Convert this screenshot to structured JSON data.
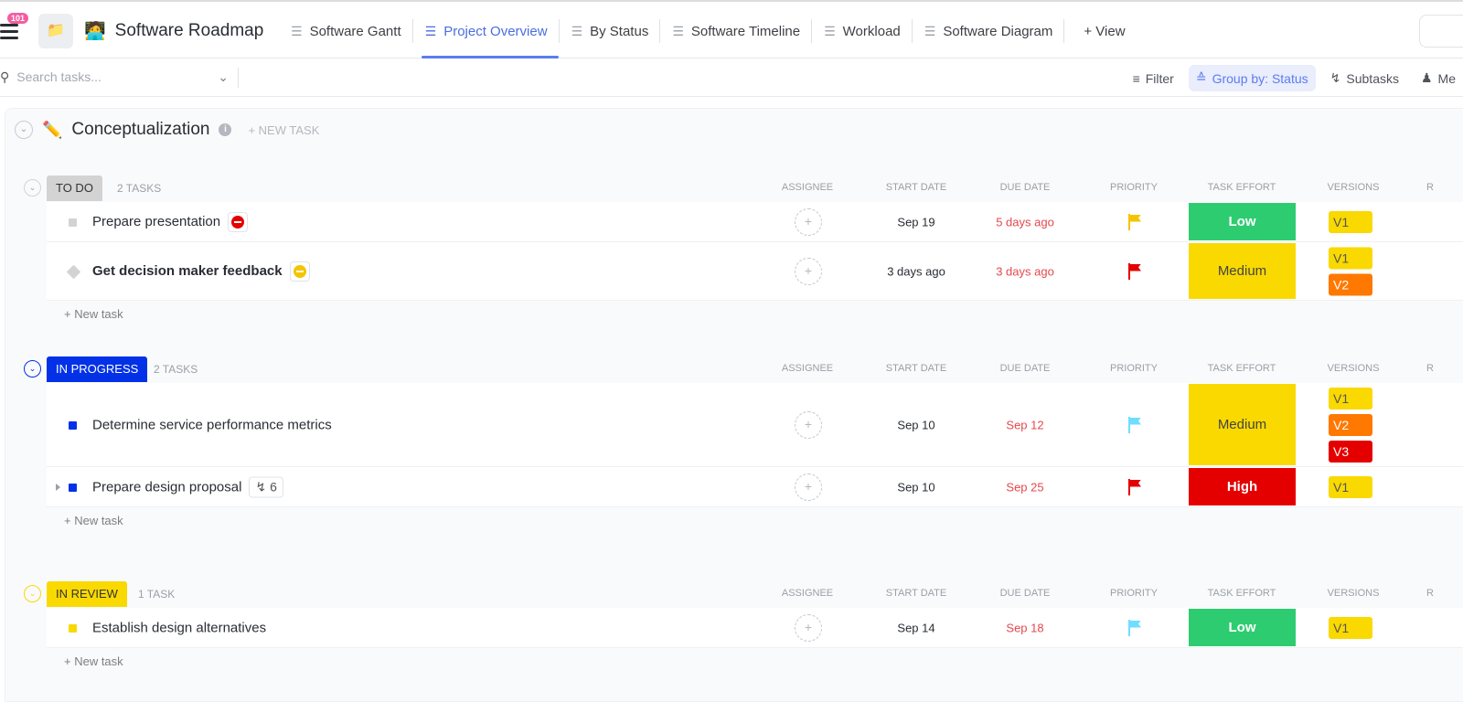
{
  "header": {
    "notifications": "101",
    "title": "Software Roadmap",
    "tabs": [
      {
        "label": "Software Gantt",
        "icon": "gantt-icon"
      },
      {
        "label": "Project Overview",
        "icon": "list-icon",
        "active": true
      },
      {
        "label": "By Status",
        "icon": "board-icon"
      },
      {
        "label": "Software Timeline",
        "icon": "timeline-icon"
      },
      {
        "label": "Workload",
        "icon": "gauge-icon"
      },
      {
        "label": "Software Diagram",
        "icon": "mindmap-icon"
      }
    ],
    "add_view": "+ View"
  },
  "toolbar": {
    "search_placeholder": "Search tasks...",
    "filter": "Filter",
    "group_by": "Group by: Status",
    "subtasks": "Subtasks",
    "me": "Me"
  },
  "list": {
    "title": "Conceptualization",
    "new_task": "+ NEW TASK"
  },
  "columns": {
    "assignee": "ASSIGNEE",
    "start": "START DATE",
    "due": "DUE DATE",
    "priority": "PRIORITY",
    "effort": "TASK EFFORT",
    "versions": "VERSIONS",
    "r": "R"
  },
  "add_task": "+ New task",
  "colors": {
    "accent": "#5b7cf0",
    "low": "#2ecc71",
    "medium": "#f9d900",
    "high": "#e50000",
    "v1": "#f9d900",
    "v2": "#ff7800",
    "v3": "#e50000"
  },
  "groups": [
    {
      "status": "TO DO",
      "count": "2 TASKS",
      "color": "#d3d3d3",
      "text": "#333",
      "tasks": [
        {
          "name": "Prepare presentation",
          "start": "Sep 19",
          "due": "5 days ago",
          "priority": "#f5c400",
          "effort": "Low",
          "versions": [
            "V1"
          ],
          "tag": "blocked"
        },
        {
          "name": "Get decision maker feedback",
          "start": "3 days ago",
          "due": "3 days ago",
          "priority": "#e50000",
          "effort": "Medium",
          "versions": [
            "V1",
            "V2"
          ],
          "tag": "waiting"
        }
      ]
    },
    {
      "status": "IN PROGRESS",
      "count": "2 TASKS",
      "color": "#0231e8",
      "text": "#fff",
      "tasks": [
        {
          "name": "Determine service performance metrics",
          "start": "Sep 10",
          "due": "Sep 12",
          "priority": "#6fddff",
          "effort": "Medium",
          "versions": [
            "V1",
            "V2",
            "V3"
          ]
        },
        {
          "name": "Prepare design proposal",
          "start": "Sep 10",
          "due": "Sep 25",
          "priority": "#e50000",
          "effort": "High",
          "versions": [
            "V1"
          ],
          "subtasks": "6"
        }
      ]
    },
    {
      "status": "IN REVIEW",
      "count": "1 TASK",
      "color": "#f9d900",
      "text": "#333",
      "tasks": [
        {
          "name": "Establish design alternatives",
          "start": "Sep 14",
          "due": "Sep 18",
          "priority": "#6fddff",
          "effort": "Low",
          "versions": [
            "V1"
          ]
        }
      ]
    }
  ]
}
